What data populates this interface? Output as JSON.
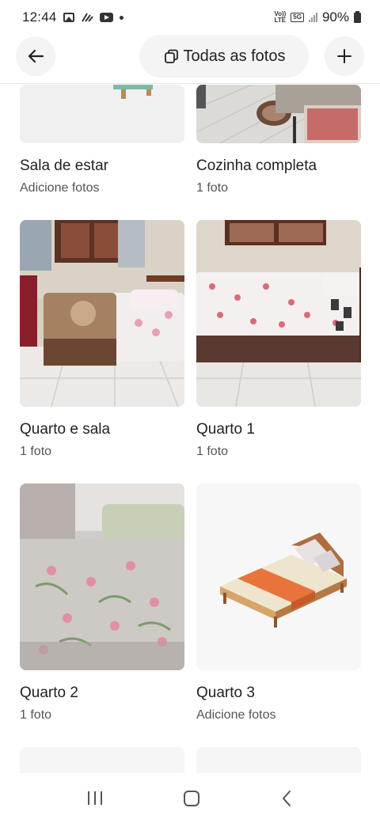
{
  "status_bar": {
    "time": "12:44",
    "network_top": "Vo))",
    "network_bottom": "LTE",
    "gen": "5G",
    "battery": "90%"
  },
  "header": {
    "title": "Todas as fotos",
    "back_icon": "arrow-left-icon",
    "add_icon": "plus-icon",
    "title_icon": "photos-stack-icon"
  },
  "rooms": [
    {
      "name": "Sala de estar",
      "status": "Adicione fotos"
    },
    {
      "name": "Cozinha completa",
      "status": "1 foto"
    },
    {
      "name": "Quarto e sala",
      "status": "1 foto"
    },
    {
      "name": "Quarto 1",
      "status": "1 foto"
    },
    {
      "name": "Quarto 2",
      "status": "1 foto"
    },
    {
      "name": "Quarto 3",
      "status": "Adicione fotos"
    }
  ],
  "nav": {
    "recents_icon": "recents-icon",
    "home_icon": "home-icon",
    "back_icon": "nav-back-icon"
  }
}
